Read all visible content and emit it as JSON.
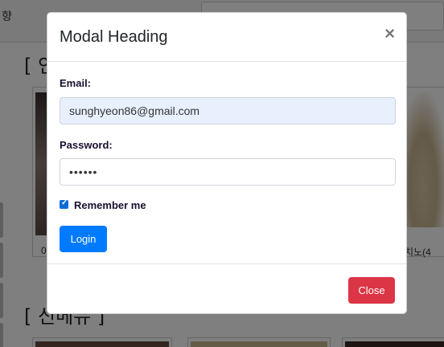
{
  "background": {
    "topbar_text": "향",
    "section1_heading": "[ 인",
    "section2_heading": "[ 신메뉴 ]",
    "card1_caption": "0",
    "card_right_caption": "푸치노(4"
  },
  "modal": {
    "title": "Modal Heading",
    "close_icon": "×",
    "email_label": "Email:",
    "email_value": "sunghyeon86@gmail.com",
    "password_label": "Password:",
    "password_value": "••••••",
    "remember_label": "Remember me",
    "remember_checked": true,
    "login_button": "Login",
    "close_button": "Close"
  },
  "colors": {
    "primary": "#007bff",
    "danger": "#dc3545",
    "autofill": "#e8f0fe"
  }
}
